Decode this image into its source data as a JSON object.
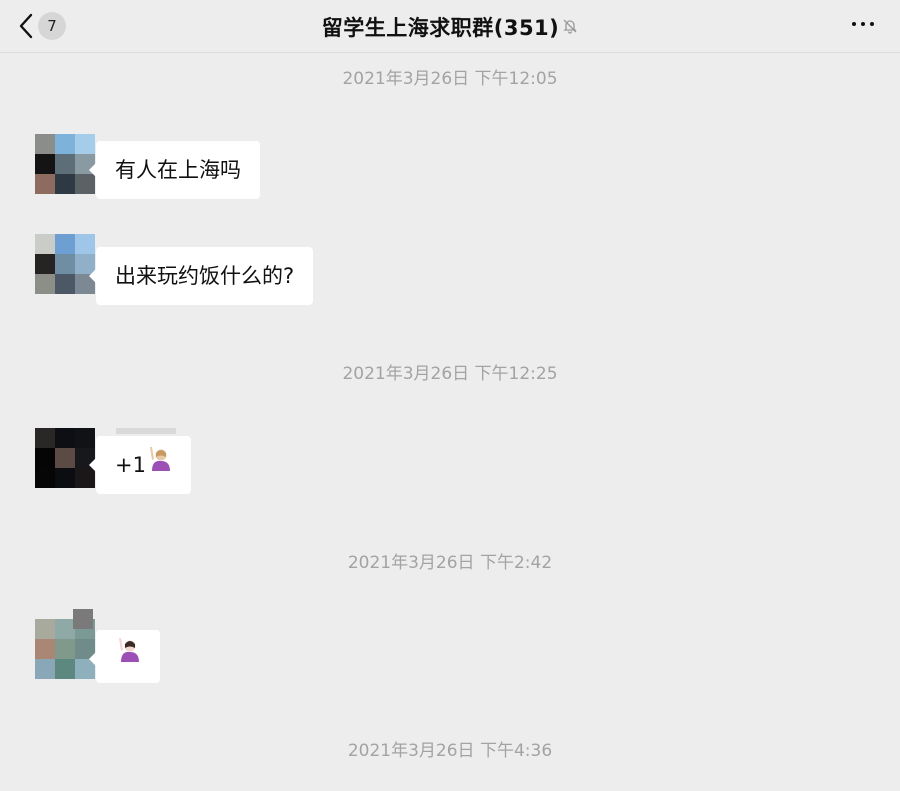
{
  "header": {
    "back_icon": "chevron-left-icon",
    "unread_count": "7",
    "title": "留学生上海求职群(351)",
    "mute_icon": "bell-off-icon",
    "more_icon": "more-dots-icon"
  },
  "timestamps": [
    "2021年3月26日 下午12:05",
    "2021年3月26日 下午12:25",
    "2021年3月26日 下午2:42",
    "2021年3月26日 下午4:36"
  ],
  "messages": [
    {
      "text": "有人在上海吗",
      "emoji": ""
    },
    {
      "text": "出来玩约饭什么的?",
      "emoji": ""
    },
    {
      "text": "+1",
      "emoji": "woman-raising-hand-emoji"
    },
    {
      "text": "",
      "emoji": "woman-raising-hand-emoji"
    }
  ],
  "colors": {
    "background": "#ededed",
    "bubble": "#ffffff",
    "timestamp": "#a3a3a3",
    "text": "#111111"
  }
}
